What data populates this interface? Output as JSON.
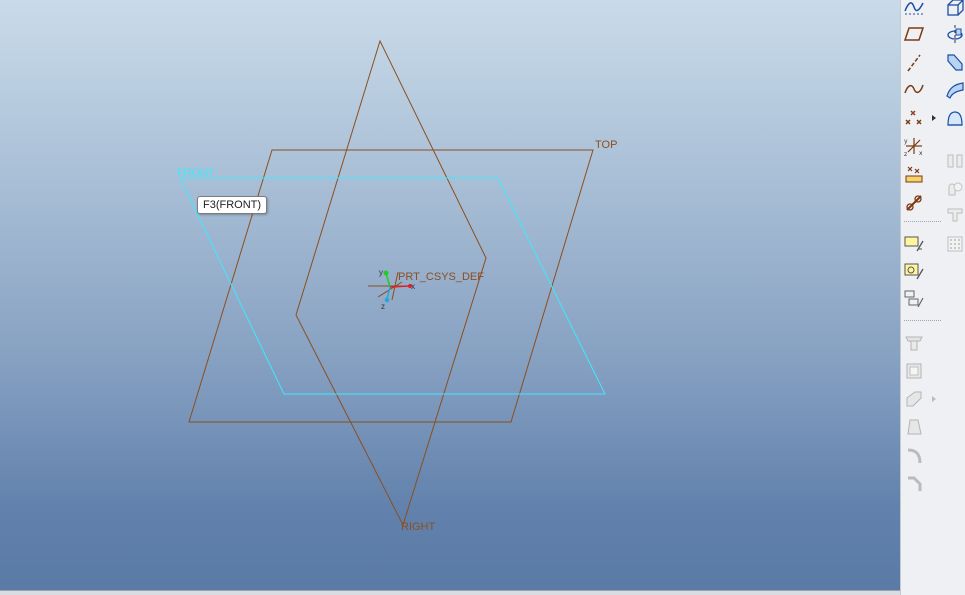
{
  "viewport": {
    "planes": {
      "top_label": "TOP",
      "front_label": "FRONT",
      "right_label": "RIGHT"
    },
    "tooltip": "F3(FRONT)",
    "csys": {
      "label": "PRT_CSYS_DEF",
      "x_letter": "x",
      "y_letter": "y",
      "z_letter": "z"
    },
    "colors": {
      "datum_plane": "#8a4f1f",
      "highlight_plane": "#40e8ff",
      "background_top": "#c9dbea",
      "background_bottom": "#5a7aa6"
    }
  },
  "toolbar": {
    "left_column": [
      {
        "icon": "sketch-tools-icon",
        "enabled": true
      },
      {
        "icon": "datum-plane-icon",
        "enabled": true
      },
      {
        "icon": "datum-axis-icon",
        "enabled": true
      },
      {
        "icon": "datum-curve-icon",
        "enabled": true
      },
      {
        "icon": "datum-point-icon",
        "enabled": true,
        "flyout": true
      },
      {
        "icon": "coordinate-system-icon",
        "enabled": true
      },
      {
        "icon": "analysis-feature-icon",
        "enabled": true
      },
      {
        "icon": "insert-reference-icon",
        "enabled": true
      },
      {
        "icon": "note-icon",
        "enabled": true
      },
      {
        "icon": "view-note-icon",
        "enabled": true
      },
      {
        "icon": "annotation-icon",
        "enabled": true
      },
      {
        "icon": "hole-icon",
        "enabled": false
      },
      {
        "icon": "shell-icon",
        "enabled": false
      },
      {
        "icon": "rib-icon",
        "enabled": false,
        "flyout": true
      },
      {
        "icon": "draft-icon",
        "enabled": false
      },
      {
        "icon": "round-icon",
        "enabled": false
      },
      {
        "icon": "chamfer-icon",
        "enabled": false
      }
    ],
    "right_column": [
      {
        "icon": "extrude-icon",
        "enabled": true
      },
      {
        "icon": "revolve-icon",
        "enabled": true
      },
      {
        "icon": "sweep-icon",
        "enabled": true
      },
      {
        "icon": "blend-icon",
        "enabled": true
      },
      {
        "icon": "boundary-blend-icon",
        "enabled": true
      },
      {
        "icon": "mirror-icon",
        "enabled": false
      },
      {
        "icon": "merge-icon",
        "enabled": false
      },
      {
        "icon": "trim-icon",
        "enabled": false
      },
      {
        "icon": "pattern-icon",
        "enabled": false
      }
    ]
  }
}
